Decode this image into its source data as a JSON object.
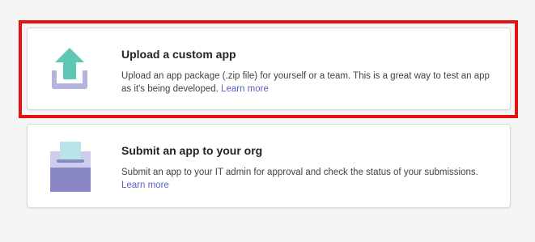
{
  "cards": [
    {
      "title": "Upload a custom app",
      "description": "Upload an app package (.zip file) for yourself or a team. This is a great way to test an app as it's being developed.",
      "link": "Learn more",
      "icon": "upload-icon"
    },
    {
      "title": "Submit an app to your org",
      "description": "Submit an app to your IT admin for approval and check the status of your submissions.",
      "link": "Learn more",
      "icon": "submit-to-org-icon"
    }
  ],
  "colors": {
    "highlight": "#e41212",
    "link": "#5b5fc7",
    "upload_arrow": "#5fc7b5",
    "tray": "#b5b3e0",
    "box_dark": "#8a88c4",
    "box_light": "#cfcdec",
    "paper": "#b9e4e8"
  }
}
